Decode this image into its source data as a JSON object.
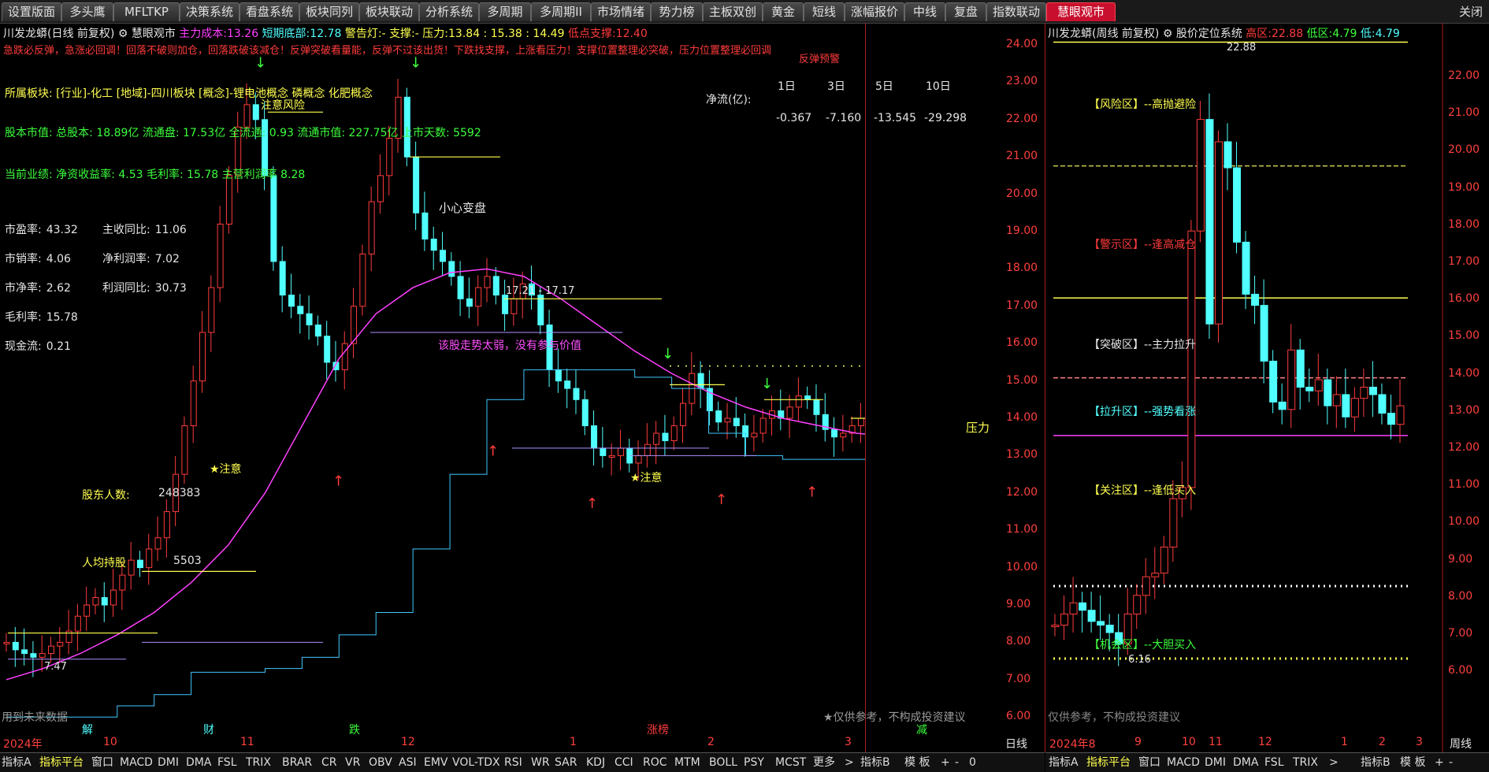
{
  "tabs": [
    "设置版面",
    "多头鹰",
    "MFLTKP",
    "决策系统",
    "看盘系统",
    "板块同列",
    "板块联动",
    "分析系统",
    "多周期",
    "多周期II",
    "市场情绪",
    "势力榜",
    "主板双创",
    "黄金",
    "短线",
    "涨幅报价",
    "中线",
    "复盘",
    "指数联动",
    "慧眼观市"
  ],
  "active_tab": "慧眼观市",
  "close_label": "关闭",
  "left_header": {
    "title": "川发龙蟒(日线 前复权)",
    "indicator_name": "慧眼观市",
    "main_cost_label": "主力成本:",
    "main_cost": "13.26",
    "short_bottom_label": "短期底部:",
    "short_bottom": "12.78",
    "alarm_label": "警告灯:",
    "alarm": "-",
    "support_label": "支撑:",
    "support": "-",
    "pressure_label": "压力:",
    "pressure": "13.84 : 15.38 : 14.49",
    "low_support_label": "低点支撑:",
    "low_support": "12.40"
  },
  "warning_line": "急跌必反弹，急涨必回调！回落不破则加仓，回落跌破该减仓！反弹突破看量能，反弹不过该出货！下跌找支撑，上涨看压力！支撑位置整理必突破，压力位置整理必回调",
  "sector": "所属板块: [行业]-化工 [地域]-四川板块 [概念]-锂电池概念 磷概念 化肥概念",
  "market_cap": "股本市值: 总股本: 18.89亿 流通盘: 17.53亿 全流通: 0.93 流通市值: 227.75亿 上市天数: 5592",
  "performance": "当前业绩: 净资收益率: 4.53 毛利率: 15.78 主营利润率 8.28",
  "stats": [
    {
      "label": "市盈率:",
      "value": "43.32"
    },
    {
      "label": "市销率:",
      "value": "4.06"
    },
    {
      "label": "市净率:",
      "value": "2.62"
    },
    {
      "label": "毛利率:",
      "value": "15.78"
    },
    {
      "label": "现金流:",
      "value": "0.21"
    }
  ],
  "stats2": [
    {
      "label": "主收同比:",
      "value": "11.06"
    },
    {
      "label": "净利润率:",
      "value": "7.02"
    },
    {
      "label": "利润同比:",
      "value": "30.73"
    }
  ],
  "net_flow": {
    "label": "净流(亿):",
    "headers": [
      "1日",
      "3日",
      "5日",
      "10日"
    ],
    "values": [
      "-0.367",
      "-7.160",
      "-13.545",
      "-29.298"
    ]
  },
  "annotations": {
    "caution_risk": "注意风险",
    "careful": "小心变盘",
    "range": "17.21 - 17.17",
    "weak_trend": "该股走势太弱，没有参与价值",
    "attention1": "★注意",
    "attention2": "★注意",
    "shareholders_label": "股东人数:",
    "shareholders": "248383",
    "people_label": "人均持股",
    "people_value": "5503",
    "pressure_tag": "压力",
    "low_label": "7.47",
    "rebound_hint": "反弹预警",
    "future_data": "用到未来数据",
    "disclaimer": "★仅供参考，不构成投资建议",
    "hint_small": "注意"
  },
  "left_axis": [
    "24.00",
    "23.00",
    "22.00",
    "21.00",
    "20.00",
    "19.00",
    "18.00",
    "17.00",
    "16.00",
    "15.00",
    "14.00",
    "13.00",
    "12.00",
    "11.00",
    "10.00",
    "9.00",
    "8.00",
    "7.00",
    "6.00"
  ],
  "left_dates": [
    "2024年",
    "10",
    "11",
    "12",
    "1",
    "2",
    "3"
  ],
  "left_markers": [
    "解",
    "财",
    "跌",
    "涨榜",
    "减"
  ],
  "period_left": "日线",
  "right_header": {
    "title": "川发龙蟒(周线 前复权)",
    "indicator_name": "股价定位系统",
    "high_label": "高区:",
    "high": "22.88",
    "low_label": "低区:",
    "low": "4.79",
    "low2_label": "低:",
    "low2": "4.79"
  },
  "zones": [
    {
      "label": "【风险区】--高抛避险",
      "color": "#ffff50"
    },
    {
      "label": "【警示区】--逢高减仓",
      "color": "#ff3b3b"
    },
    {
      "label": "【突破区】--主力拉升",
      "color": "#e6e6e6"
    },
    {
      "label": "【拉升区】--强势看涨",
      "color": "#50ffff"
    },
    {
      "label": "【关注区】--逢低买入",
      "color": "#ffff50"
    },
    {
      "label": "【机会区】--大胆买入",
      "color": "#3cff3c"
    }
  ],
  "right_high_tag": "22.88",
  "right_low_tag": "6.16",
  "right_disclaimer": "仅供参考，不构成投资建议",
  "right_axis": [
    "22.00",
    "21.00",
    "20.00",
    "19.00",
    "18.00",
    "17.00",
    "16.00",
    "15.00",
    "14.00",
    "13.00",
    "12.00",
    "11.00",
    "10.00",
    "9.00",
    "8.00",
    "7.00",
    "6.00"
  ],
  "right_dates": [
    "2024年8",
    "9",
    "10",
    "11",
    "12",
    "1",
    "2",
    "3"
  ],
  "period_right": "周线",
  "bottom_left_tabs": [
    "指标A",
    "指标平台",
    "窗口",
    "MACD",
    "DMI",
    "DMA",
    "FSL",
    "TRIX",
    "BRAR",
    "CR",
    "VR",
    "OBV",
    "ASI",
    "EMV",
    "VOL-TDX",
    "RSI",
    "WR",
    "SAR",
    "KDJ",
    "CCI",
    "ROC",
    "MTM",
    "BOLL",
    "PSY",
    "MCST",
    "更多",
    ">",
    "指标B",
    "模 板",
    "+",
    "-",
    "0"
  ],
  "bottom_right_tabs": [
    "指标A",
    "指标平台",
    "窗口",
    "MACD",
    "DMI",
    "DMA",
    "FSL",
    "TRIX",
    ">",
    "指标B",
    "模 板",
    "+",
    "-"
  ],
  "colors": {
    "accent": "#c8102e",
    "up": "#ff3b3b",
    "down": "#50ffff",
    "ma": "#ff40ff"
  }
}
